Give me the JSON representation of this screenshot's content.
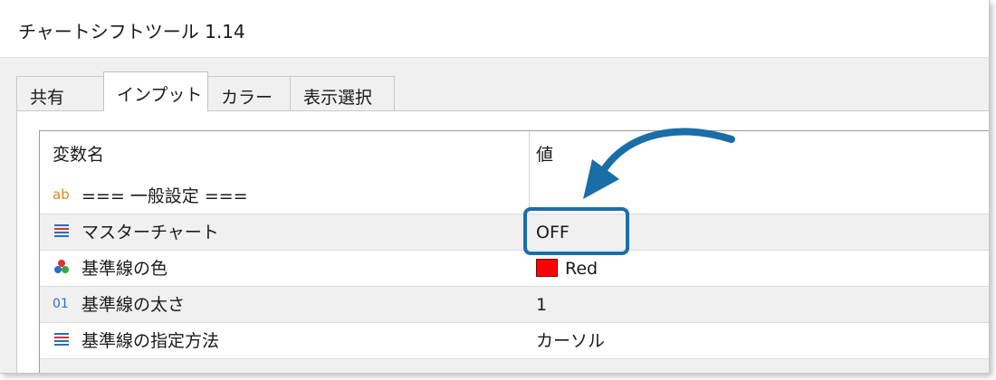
{
  "window": {
    "title": "チャートシフトツール 1.14"
  },
  "tabs": [
    {
      "label": "共有",
      "active": false
    },
    {
      "label": "インプット",
      "active": true
    },
    {
      "label": "カラー",
      "active": false
    },
    {
      "label": "表示選択",
      "active": false
    }
  ],
  "table": {
    "headers": {
      "name": "変数名",
      "value": "値"
    },
    "rows": [
      {
        "icon": "ab-string-icon",
        "name": "=== 一般設定 ===",
        "value": ""
      },
      {
        "icon": "enum-list-icon",
        "name": "マスターチャート",
        "value": "OFF"
      },
      {
        "icon": "color-palette-icon",
        "name": "基準線の色",
        "value": "Red",
        "swatch_color": "#ff0000"
      },
      {
        "icon": "integer-icon",
        "name": "基準線の太さ",
        "value": "1"
      },
      {
        "icon": "enum-list-icon",
        "name": "基準線の指定方法",
        "value": "カーソル"
      }
    ]
  },
  "colors": {
    "accent": "#1a6ea8",
    "icon_orange": "#d98a1e",
    "icon_red": "#e03030",
    "icon_blue": "#2a6fb8"
  }
}
